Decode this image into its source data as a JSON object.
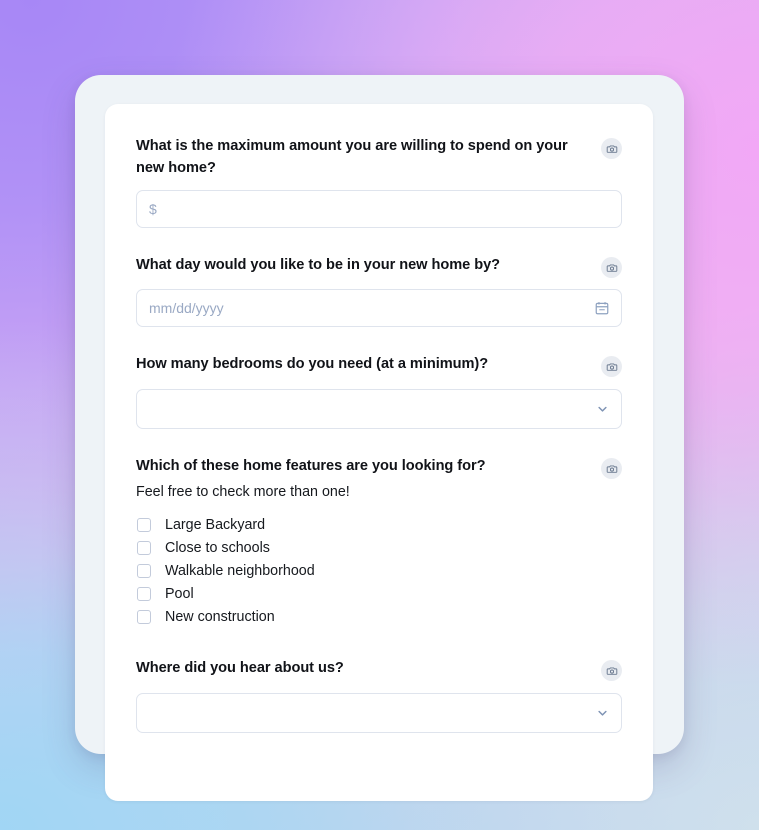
{
  "background": {
    "top_left_color": "#a787f6",
    "top_right_color": "#f0aef2",
    "bottom_left_color": "#a6d6f5",
    "bottom_right_color": "#dfe4ee"
  },
  "card": {
    "outer_background": "#eef3f7",
    "inner_background": "#ffffff"
  },
  "questions": [
    {
      "id": "budget",
      "label": "What is the maximum amount you are willing to spend on your new home?",
      "icon": "camera-icon",
      "input": {
        "type": "text",
        "placeholder": "$",
        "value": ""
      }
    },
    {
      "id": "move-in-date",
      "label": "What day would you like to be in your new home by?",
      "icon": "camera-icon",
      "input": {
        "type": "date",
        "placeholder": "mm/dd/yyyy",
        "value": "",
        "trailing_icon": "calendar-icon"
      }
    },
    {
      "id": "bedrooms",
      "label": "How many bedrooms do you need (at a minimum)?",
      "icon": "camera-icon",
      "input": {
        "type": "select",
        "value": "",
        "trailing_icon": "chevron-down-icon"
      }
    },
    {
      "id": "home-features",
      "label": "Which of these home features are you looking for?",
      "sublabel": "Feel free to check more than one!",
      "icon": "camera-icon",
      "options": [
        {
          "label": "Large Backyard",
          "checked": false
        },
        {
          "label": "Close to schools",
          "checked": false
        },
        {
          "label": "Walkable neighborhood",
          "checked": false
        },
        {
          "label": "Pool",
          "checked": false
        },
        {
          "label": "New construction",
          "checked": false
        }
      ]
    },
    {
      "id": "referral-source",
      "label": "Where did you hear about us?",
      "icon": "camera-icon",
      "input": {
        "type": "select",
        "value": "",
        "trailing_icon": "chevron-down-icon"
      }
    }
  ]
}
